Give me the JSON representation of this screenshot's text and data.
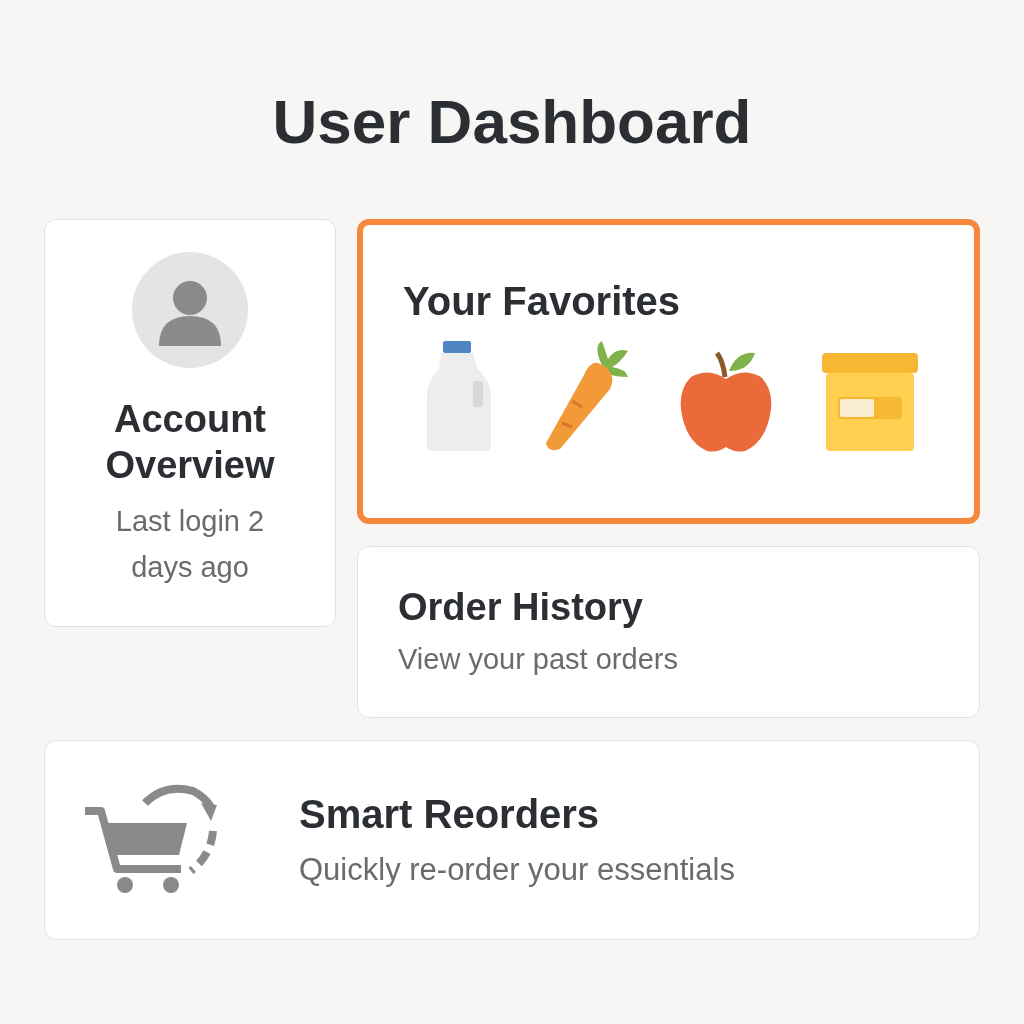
{
  "title": "User Dashboard",
  "account": {
    "title": "Account Overview",
    "subtitle": "Last login 2 days ago"
  },
  "favorites": {
    "title": "Your Favorites",
    "highlighted": true
  },
  "order_history": {
    "title": "Order History",
    "subtitle": "View your past orders"
  },
  "smart_reorders": {
    "title": "Smart Reorders",
    "subtitle": "Quickly re-order your essentials"
  }
}
